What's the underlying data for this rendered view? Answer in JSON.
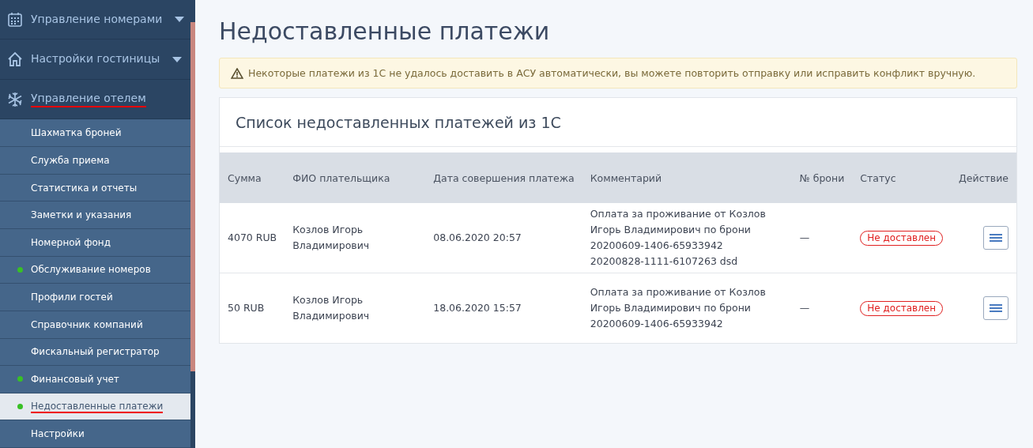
{
  "sidebar": {
    "sections": [
      {
        "label": "Управление номерами",
        "kind": "calendar",
        "caret": true,
        "selected": false
      },
      {
        "label": "Настройки гостиницы",
        "kind": "house",
        "caret": true,
        "selected": false
      },
      {
        "label": "Управление отелем",
        "kind": "snowflake",
        "caret": false,
        "selected": true
      }
    ],
    "items": [
      {
        "label": "Шахматка броней",
        "dot": false,
        "selected": false
      },
      {
        "label": "Служба приема",
        "dot": false,
        "selected": false
      },
      {
        "label": "Статистика и отчеты",
        "dot": false,
        "selected": false
      },
      {
        "label": "Заметки и указания",
        "dot": false,
        "selected": false
      },
      {
        "label": "Номерной фонд",
        "dot": false,
        "selected": false
      },
      {
        "label": "Обслуживание номеров",
        "dot": true,
        "selected": false
      },
      {
        "label": "Профили гостей",
        "dot": false,
        "selected": false
      },
      {
        "label": "Справочник компаний",
        "dot": false,
        "selected": false
      },
      {
        "label": "Фискальный регистратор",
        "dot": false,
        "selected": false
      },
      {
        "label": "Финансовый учет",
        "dot": true,
        "selected": false
      },
      {
        "label": "Недоставленные платежи",
        "dot": true,
        "selected": true
      },
      {
        "label": "Настройки",
        "dot": false,
        "selected": false
      }
    ]
  },
  "page": {
    "title": "Недоставленные платежи",
    "alert": "Некоторые платежи из 1С не удалось доставить в АСУ автоматически, вы можете повторить отправку или исправить конфликт вручную.",
    "card_title": "Список недоставленных платежей из 1С",
    "table": {
      "columns": [
        "Сумма",
        "ФИО плательщика",
        "Дата совершения платежа",
        "Комментарий",
        "№ брони",
        "Статус",
        "Действие"
      ],
      "rows": [
        {
          "amount": "4070 RUB",
          "payer": "Козлов Игорь Владимирович",
          "date": "08.06.2020 20:57",
          "comment": "Оплата за проживание от Козлов Игорь Владимирович по брони 20200609-1406-65933942\n 20200828-1111-6107263 dsd",
          "booking": "—",
          "status": "Не доставлен"
        },
        {
          "amount": "50 RUB",
          "payer": "Козлов Игорь Владимирович",
          "date": "18.06.2020 15:57",
          "comment": "Оплата за проживание от Козлов Игорь Владимирович по брони 20200609-1406-65933942",
          "booking": "—",
          "status": "Не доставлен"
        }
      ]
    }
  }
}
